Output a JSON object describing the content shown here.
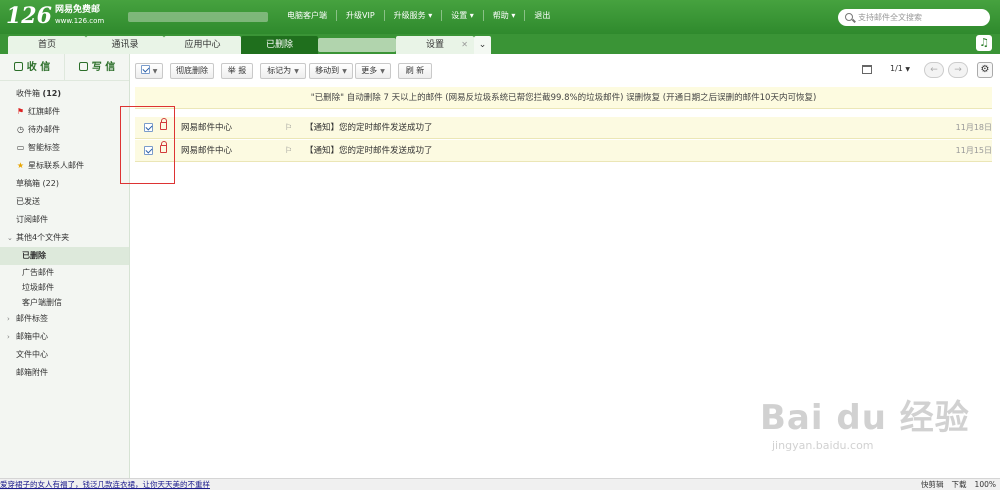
{
  "topbar": {
    "logo_number": "126",
    "logo_name": "网易免费邮",
    "logo_url": "www.126.com",
    "nav": [
      "电脑客户端",
      "升级VIP",
      "升级服务 ▾",
      "设置 ▾",
      "帮助 ▾",
      "退出"
    ],
    "search_placeholder": "支持邮件全文搜索"
  },
  "tabs": [
    {
      "label": "首页"
    },
    {
      "label": "通讯录"
    },
    {
      "label": "应用中心"
    },
    {
      "label": "已删除"
    },
    {
      "label": "设置"
    }
  ],
  "sidebar": {
    "receive": "收 信",
    "write": "写 信",
    "folders": [
      {
        "label": "收件箱",
        "count": "(12)",
        "icon": "inbox"
      },
      {
        "label": "红旗邮件",
        "icon": "red-flag"
      },
      {
        "label": "待办邮件",
        "icon": "clock"
      },
      {
        "label": "智能标签",
        "icon": "tag"
      },
      {
        "label": "星标联系人邮件",
        "icon": "star"
      },
      {
        "label": "草稿箱 (22)",
        "icon": "draft"
      },
      {
        "label": "已发送",
        "icon": "sent"
      },
      {
        "label": "订阅邮件",
        "icon": "subscribe"
      },
      {
        "label": "其他4个文件夹",
        "icon": "folder-group"
      },
      {
        "label": "已删除",
        "icon": "trash"
      },
      {
        "label": "广告邮件",
        "icon": "ad"
      },
      {
        "label": "垃圾邮件",
        "icon": "spam"
      },
      {
        "label": "客户端删信",
        "icon": "client-deleted"
      },
      {
        "label": "邮件标签",
        "icon": "label"
      },
      {
        "label": "邮箱中心",
        "icon": "mailbox-center"
      },
      {
        "label": "文件中心",
        "icon": "file-center"
      },
      {
        "label": "邮箱附件",
        "icon": "attachment"
      }
    ]
  },
  "toolbar": {
    "perm_delete": "彻底删除",
    "report": "举 报",
    "mark_as": "标记为",
    "move_to": "移动到",
    "more": "更多",
    "refresh": "刷 新",
    "page": "1/1"
  },
  "notice": "\"已删除\" 自动删除 7 天以上的邮件 (网易反垃圾系统已帮您拦截99.8%的垃圾邮件) 误删恢复 (开通日期之后误删的邮件10天内可恢复)",
  "mails": [
    {
      "from": "网易邮件中心",
      "subject": "【通知】您的定时邮件发送成功了",
      "date": "11月18日"
    },
    {
      "from": "网易邮件中心",
      "subject": "【通知】您的定时邮件发送成功了",
      "date": "11月15日"
    }
  ],
  "statusbar": {
    "ad": "爱穿裙子的女人有福了，钱泛几款连衣裙，让你天天美的不重样",
    "items": [
      "快剪辑",
      "下载",
      "100%"
    ]
  },
  "watermark": {
    "main": "Bai du 经验",
    "sub": "jingyan.baidu.com"
  },
  "colors": {
    "brand": "#3a9436",
    "active_tab": "#1f6f1d",
    "notice_bg": "#fdfbe0",
    "highlight": "#d33"
  }
}
